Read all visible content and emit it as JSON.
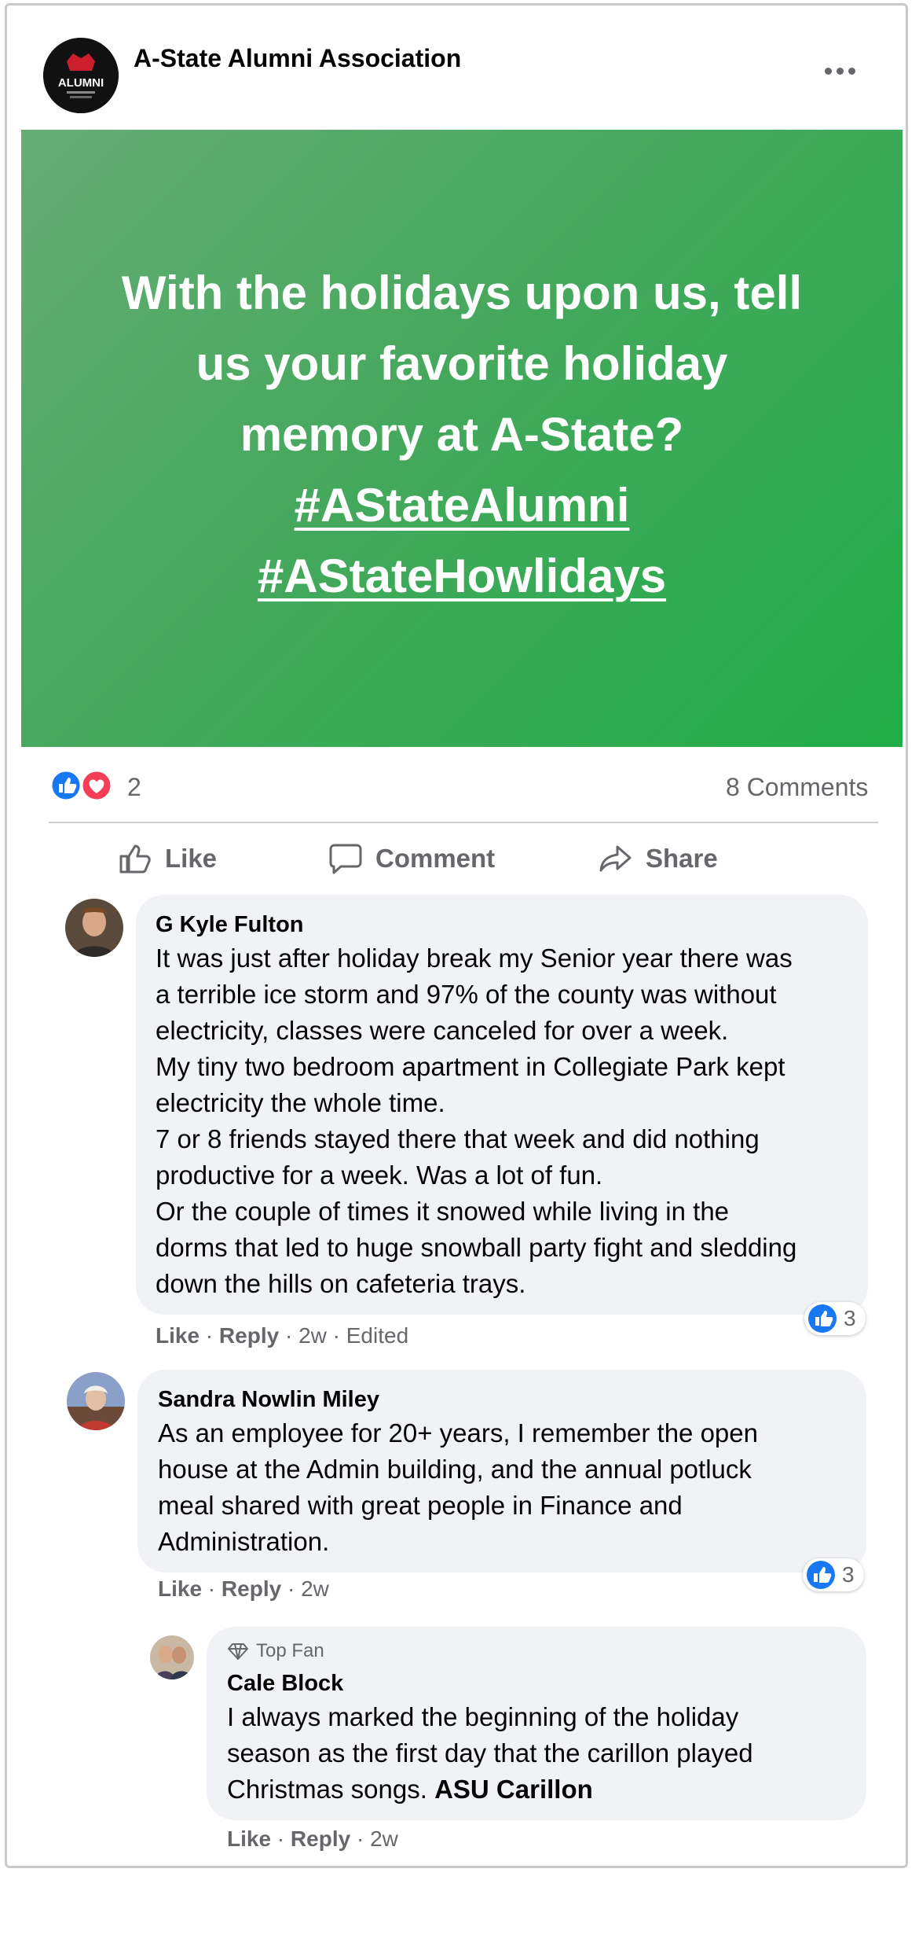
{
  "post": {
    "page_name": "A-State Alumni Association",
    "avatar_text": "ALUMNI",
    "image_lines": [
      "With the holidays upon us, tell",
      "us your favorite holiday",
      "memory at A-State?"
    ],
    "hashtags": [
      "#AStateAlumni",
      "#AStateHowlidays"
    ],
    "reaction_count": "2",
    "comments_count": "8 Comments",
    "colors": {
      "image_green": "#45a85d",
      "like_blue": "#1877f2",
      "love_red": "#f33e58"
    }
  },
  "actions": {
    "like": "Like",
    "comment": "Comment",
    "share": "Share"
  },
  "comments": [
    {
      "author": "G Kyle Fulton",
      "lines": [
        "It was just after holiday break my Senior year there was",
        "a terrible ice storm and 97% of the county was without",
        "electricity, classes were canceled for over a week.",
        "My tiny two bedroom apartment in Collegiate Park kept",
        "electricity the whole time.",
        "7 or 8 friends stayed there that week and did nothing",
        "productive for a week. Was a lot of fun.",
        "Or the couple of times it snowed while living in the",
        "dorms that led to huge snowball party fight and sledding",
        "down the hills on cafeteria trays."
      ],
      "like": "Like",
      "reply": "Reply",
      "time": "2w",
      "edited": "Edited",
      "reactions": "3"
    },
    {
      "author": "Sandra Nowlin Miley",
      "lines": [
        "As an employee for 20+ years, I remember the open",
        "house at the Admin building, and the annual potluck",
        "meal shared with great people in Finance and",
        "Administration."
      ],
      "like": "Like",
      "reply": "Reply",
      "time": "2w",
      "reactions": "3"
    }
  ],
  "reply": {
    "badge": "Top Fan",
    "author": "Cale Block",
    "lines": [
      "I always marked the beginning of the holiday",
      "season as the first day that the carillon played"
    ],
    "last_line_prefix": "Christmas songs.",
    "mention": "ASU Carillon",
    "like": "Like",
    "reply": "Reply",
    "time": "2w"
  }
}
